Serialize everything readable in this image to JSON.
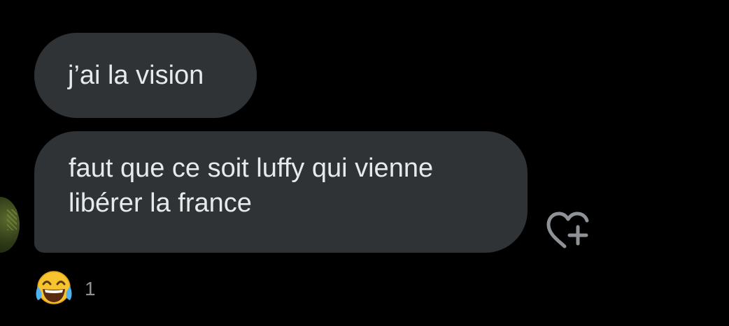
{
  "messages": [
    {
      "text": "j’ai la vision"
    },
    {
      "text": "faut que ce soit luffy qui vienne libérer la france"
    }
  ],
  "reactions": {
    "emoji_icon": "face-with-tears-of-joy-icon",
    "count": "1"
  },
  "add_reaction_icon": "heart-plus-icon",
  "colors": {
    "background": "#000000",
    "bubble": "#2f3336",
    "text": "#e7e9ea",
    "muted": "#8e9297"
  }
}
